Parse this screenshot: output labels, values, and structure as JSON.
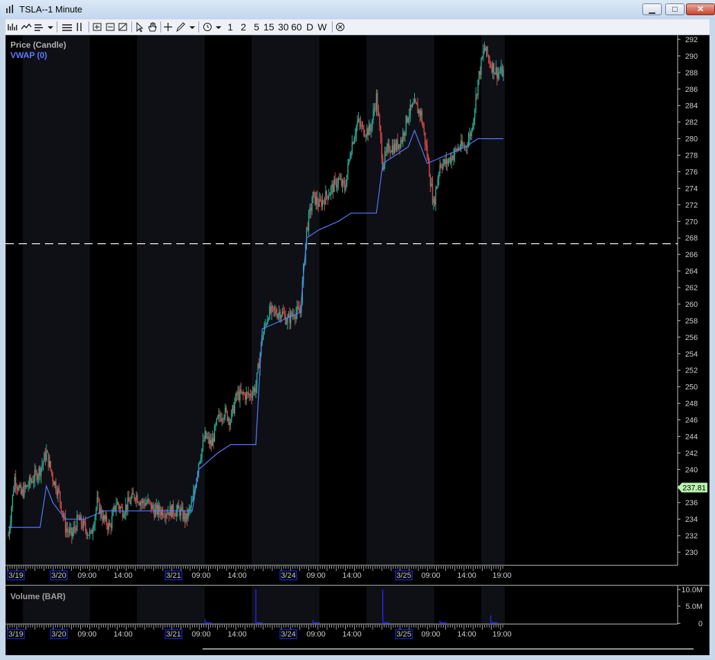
{
  "window": {
    "title": "TSLA--1 Minute",
    "minimize_label": "▁",
    "maximize_label": "□",
    "close_label": "✕"
  },
  "toolbar": {
    "periods": [
      "1",
      "2",
      "5",
      "15",
      "30",
      "60",
      "D",
      "W"
    ]
  },
  "price_pane": {
    "title": "Price (Candle)",
    "indicator": "VWAP (0)",
    "current_price": "237.81",
    "y_ticks": [
      "292",
      "290",
      "288",
      "286",
      "284",
      "282",
      "280",
      "278",
      "276",
      "274",
      "272",
      "270",
      "268",
      "266",
      "264",
      "262",
      "260",
      "258",
      "256",
      "254",
      "252",
      "250",
      "248",
      "246",
      "244",
      "242",
      "240",
      "238",
      "236",
      "234",
      "232",
      "230"
    ],
    "x_labels": [
      "3/19",
      "3/20",
      "09:00",
      "14:00",
      "3/21",
      "09:00",
      "14:00",
      "3/24",
      "09:00",
      "14:00",
      "3/25",
      "09:00",
      "14:00",
      "19:00"
    ],
    "dashed_level": 267.3
  },
  "volume_pane": {
    "title": "Volume (BAR)",
    "y_ticks": [
      "10.0M",
      "5.0M",
      "0"
    ],
    "x_labels": [
      "3/19",
      "3/20",
      "09:00",
      "14:00",
      "3/21",
      "09:00",
      "14:00",
      "3/24",
      "09:00",
      "14:00",
      "3/25",
      "09:00",
      "14:00",
      "19:00"
    ]
  },
  "colors": {
    "background": "#000000",
    "session_band": "#0e1016",
    "up_candle": "#2bb39a",
    "down_candle": "#e04c4c",
    "vwap": "#5a7cff",
    "axis_text": "#d0d0d0",
    "price_badge": "#b9f5b0",
    "volume": "#2a2aff"
  },
  "chart_data": {
    "type": "candlestick",
    "title": "Price (Candle)",
    "y_range": [
      229,
      292
    ],
    "vwap_name": "VWAP (0)",
    "price_path": [
      [
        0,
        232
      ],
      [
        1,
        239
      ],
      [
        2,
        237
      ],
      [
        3,
        238
      ],
      [
        4,
        239
      ],
      [
        5,
        240
      ],
      [
        6,
        242
      ],
      [
        7,
        239
      ],
      [
        8,
        237
      ],
      [
        9,
        233
      ],
      [
        10,
        232
      ],
      [
        11,
        234
      ],
      [
        12,
        233
      ],
      [
        13,
        232
      ],
      [
        14,
        236
      ],
      [
        15,
        234
      ],
      [
        16,
        233
      ],
      [
        17,
        236
      ],
      [
        18,
        235
      ],
      [
        19,
        236
      ],
      [
        20,
        237
      ],
      [
        21,
        236
      ],
      [
        22,
        236
      ],
      [
        23,
        235
      ],
      [
        24,
        235
      ],
      [
        25,
        235
      ],
      [
        26,
        235
      ],
      [
        27,
        235
      ],
      [
        28,
        234
      ],
      [
        29,
        236
      ],
      [
        30,
        241
      ],
      [
        31,
        244
      ],
      [
        32,
        243
      ],
      [
        33,
        246
      ],
      [
        34,
        247
      ],
      [
        35,
        246
      ],
      [
        36,
        249
      ],
      [
        37,
        249
      ],
      [
        38,
        249
      ],
      [
        39,
        250
      ],
      [
        40,
        256
      ],
      [
        41,
        259
      ],
      [
        42,
        259
      ],
      [
        43,
        259
      ],
      [
        44,
        258
      ],
      [
        45,
        259
      ],
      [
        46,
        259
      ],
      [
        47,
        269
      ],
      [
        48,
        273
      ],
      [
        49,
        272
      ],
      [
        50,
        273
      ],
      [
        51,
        274
      ],
      [
        52,
        275
      ],
      [
        53,
        274
      ],
      [
        54,
        279
      ],
      [
        55,
        282
      ],
      [
        56,
        281
      ],
      [
        57,
        281
      ],
      [
        58,
        285
      ],
      [
        59,
        277
      ],
      [
        60,
        279
      ],
      [
        61,
        279
      ],
      [
        62,
        280
      ],
      [
        63,
        283
      ],
      [
        64,
        284
      ],
      [
        65,
        283
      ],
      [
        66,
        278
      ],
      [
        67,
        272
      ],
      [
        68,
        277
      ],
      [
        69,
        277
      ],
      [
        70,
        278
      ],
      [
        71,
        279
      ],
      [
        72,
        279
      ],
      [
        73,
        281
      ],
      [
        74,
        287
      ],
      [
        75,
        291
      ],
      [
        76,
        289
      ],
      [
        77,
        288
      ],
      [
        78,
        288
      ]
    ],
    "vwap_path": [
      [
        0,
        233
      ],
      [
        3,
        233
      ],
      [
        5,
        233
      ],
      [
        6,
        238
      ],
      [
        7,
        236
      ],
      [
        9,
        234
      ],
      [
        12,
        234
      ],
      [
        15,
        235
      ],
      [
        18,
        235
      ],
      [
        22,
        235
      ],
      [
        27,
        235
      ],
      [
        28,
        235
      ],
      [
        29,
        235
      ],
      [
        30,
        240
      ],
      [
        33,
        242
      ],
      [
        35,
        243
      ],
      [
        39,
        243
      ],
      [
        40,
        257
      ],
      [
        46,
        259
      ],
      [
        47,
        268
      ],
      [
        49,
        269
      ],
      [
        52,
        270
      ],
      [
        54,
        271
      ],
      [
        58,
        271
      ],
      [
        59,
        277
      ],
      [
        61,
        278
      ],
      [
        63,
        279
      ],
      [
        64,
        281
      ],
      [
        66,
        277
      ],
      [
        69,
        278
      ],
      [
        72,
        279
      ],
      [
        74,
        280
      ],
      [
        78,
        280
      ]
    ],
    "volume_spikes": [
      {
        "x": 31,
        "value": 1.4
      },
      {
        "x": 39,
        "value": 10.0
      },
      {
        "x": 48,
        "value": 1.2
      },
      {
        "x": 59,
        "value": 10.0
      },
      {
        "x": 68,
        "value": 1.0
      },
      {
        "x": 76,
        "value": 2.5
      }
    ],
    "x_labels": [
      "3/19",
      "3/20",
      "09:00",
      "14:00",
      "3/21",
      "09:00",
      "14:00",
      "3/24",
      "09:00",
      "14:00",
      "3/25",
      "09:00",
      "14:00",
      "19:00"
    ]
  }
}
